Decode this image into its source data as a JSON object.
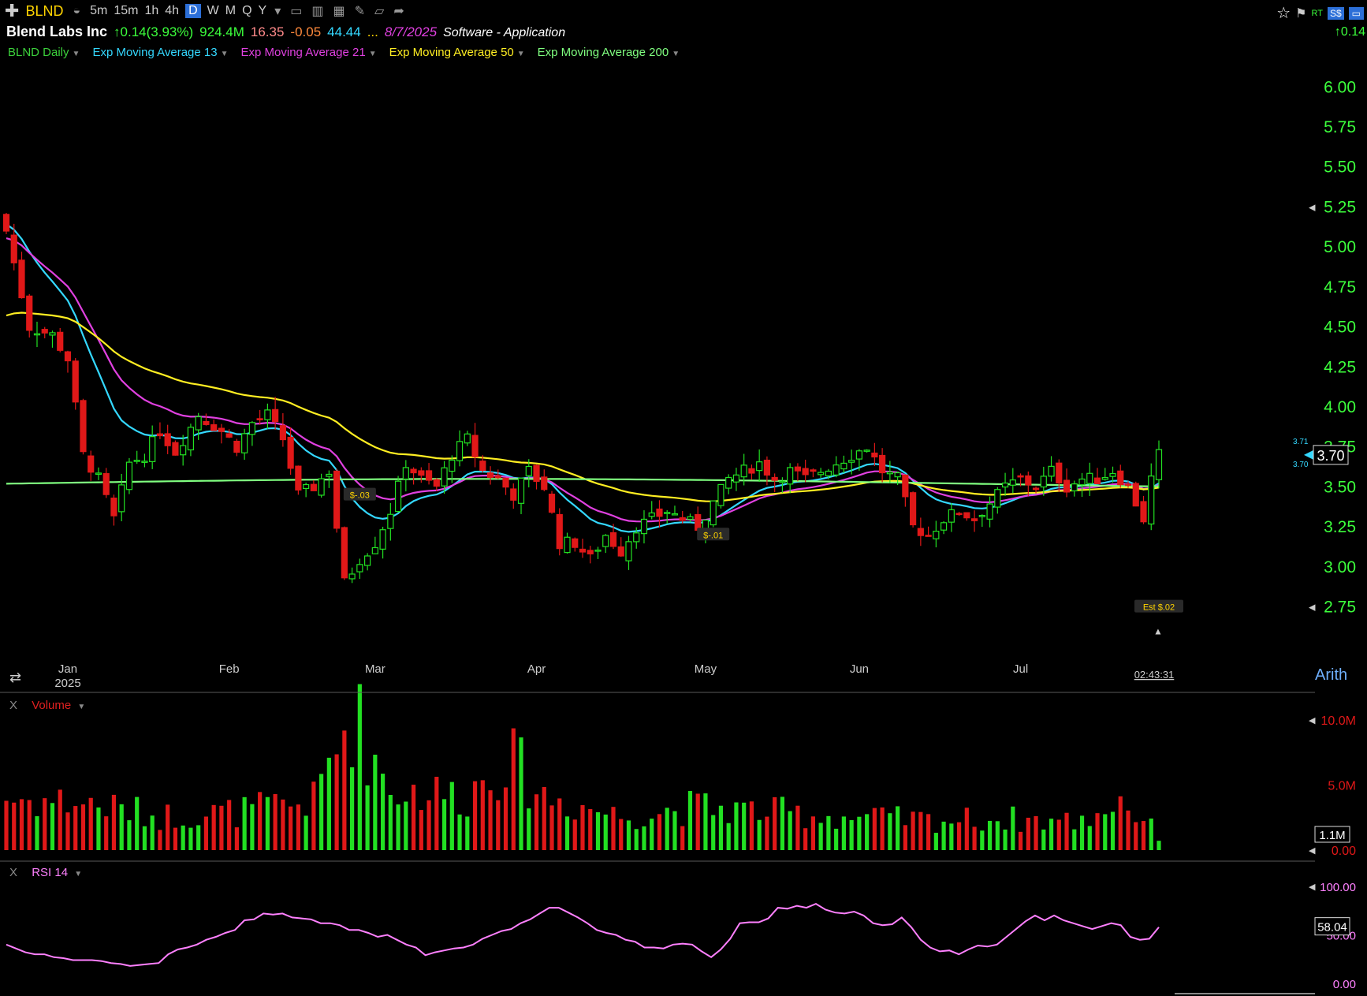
{
  "toolbar": {
    "symbol": "BLND",
    "timeframes": [
      "5m",
      "15m",
      "1h",
      "4h",
      "D",
      "W",
      "M",
      "Q",
      "Y"
    ],
    "active_timeframe": "D",
    "right_badges": [
      "RT"
    ]
  },
  "header": {
    "company": "Blend Labs Inc",
    "change": "↑0.14(3.93%)",
    "volume": "924.4M",
    "val1": "16.35",
    "val2": "-0.05",
    "val3": "44.44",
    "ellipsis": "...",
    "date": "8/7/2025",
    "industry": "Software - Application",
    "right_change": "↑0.14"
  },
  "legend": [
    {
      "label": "BLND Daily",
      "color": "#3cd23c"
    },
    {
      "label": "Exp Moving Average 13",
      "color": "#34d8ff"
    },
    {
      "label": "Exp Moving Average 21",
      "color": "#e040e0"
    },
    {
      "label": "Exp Moving Average 50",
      "color": "#ffee22"
    },
    {
      "label": "Exp Moving Average 200",
      "color": "#80ff80"
    }
  ],
  "chart_data": {
    "type": "candlestick",
    "ylim": [
      2.6,
      6.1
    ],
    "y_ticks": [
      "6.00",
      "5.75",
      "5.50",
      "5.25",
      "5.00",
      "4.75",
      "4.50",
      "4.25",
      "4.00",
      "3.75",
      "3.50",
      "3.25",
      "3.00",
      "2.75"
    ],
    "x_ticks": [
      {
        "label": "Jan",
        "sub": "2025",
        "day": 0
      },
      {
        "label": "Feb",
        "day": 21
      },
      {
        "label": "Mar",
        "day": 40
      },
      {
        "label": "Apr",
        "day": 61
      },
      {
        "label": "May",
        "day": 83
      },
      {
        "label": "Jun",
        "day": 103
      },
      {
        "label": "Jul",
        "day": 124
      }
    ],
    "last_price": "3.70",
    "hi_label": "3.71",
    "lo_label": "3.70",
    "time_label": "02:43:31",
    "earnings": [
      {
        "label": "$-.03",
        "day": 46,
        "price": 3.45
      },
      {
        "label": "$-.01",
        "day": 92,
        "price": 3.2
      },
      {
        "label": "Est $.02",
        "day": 150,
        "price": 2.75
      }
    ],
    "key_points": [
      [
        0,
        5.1
      ],
      [
        3,
        4.5
      ],
      [
        6,
        4.45
      ],
      [
        8,
        4.3
      ],
      [
        10,
        3.7
      ],
      [
        12,
        3.55
      ],
      [
        14,
        3.3
      ],
      [
        16,
        3.65
      ],
      [
        18,
        3.7
      ],
      [
        20,
        3.85
      ],
      [
        22,
        3.72
      ],
      [
        25,
        3.95
      ],
      [
        28,
        3.85
      ],
      [
        30,
        3.75
      ],
      [
        32,
        3.9
      ],
      [
        34,
        3.95
      ],
      [
        36,
        3.8
      ],
      [
        38,
        3.45
      ],
      [
        40,
        3.5
      ],
      [
        42,
        3.6
      ],
      [
        44,
        2.9
      ],
      [
        46,
        3.05
      ],
      [
        48,
        3.15
      ],
      [
        50,
        3.35
      ],
      [
        52,
        3.65
      ],
      [
        54,
        3.55
      ],
      [
        56,
        3.5
      ],
      [
        58,
        3.7
      ],
      [
        60,
        3.8
      ],
      [
        62,
        3.6
      ],
      [
        64,
        3.55
      ],
      [
        66,
        3.45
      ],
      [
        68,
        3.6
      ],
      [
        70,
        3.5
      ],
      [
        72,
        3.15
      ],
      [
        74,
        3.15
      ],
      [
        76,
        3.05
      ],
      [
        78,
        3.2
      ],
      [
        80,
        3.1
      ],
      [
        82,
        3.25
      ],
      [
        84,
        3.3
      ],
      [
        86,
        3.35
      ],
      [
        88,
        3.3
      ],
      [
        90,
        3.25
      ],
      [
        92,
        3.4
      ],
      [
        94,
        3.55
      ],
      [
        96,
        3.6
      ],
      [
        98,
        3.65
      ],
      [
        100,
        3.55
      ],
      [
        102,
        3.6
      ],
      [
        104,
        3.55
      ],
      [
        106,
        3.6
      ],
      [
        108,
        3.65
      ],
      [
        110,
        3.7
      ],
      [
        112,
        3.75
      ],
      [
        114,
        3.6
      ],
      [
        116,
        3.55
      ],
      [
        118,
        3.25
      ],
      [
        120,
        3.2
      ],
      [
        122,
        3.3
      ],
      [
        124,
        3.35
      ],
      [
        126,
        3.3
      ],
      [
        128,
        3.4
      ],
      [
        130,
        3.5
      ],
      [
        132,
        3.55
      ],
      [
        134,
        3.5
      ],
      [
        136,
        3.6
      ],
      [
        138,
        3.5
      ],
      [
        140,
        3.55
      ],
      [
        142,
        3.55
      ],
      [
        144,
        3.6
      ],
      [
        146,
        3.5
      ],
      [
        148,
        3.3
      ],
      [
        149,
        3.55
      ],
      [
        150,
        3.7
      ]
    ],
    "volume": {
      "ylim": [
        0,
        10.5
      ],
      "ticks": [
        "10.0M",
        "5.0M",
        "0.00"
      ],
      "current": "1.1M",
      "key_points": [
        [
          0,
          3.8
        ],
        [
          10,
          3.5
        ],
        [
          20,
          2.5
        ],
        [
          30,
          2.8
        ],
        [
          40,
          3.6
        ],
        [
          45,
          10.2
        ],
        [
          50,
          4.5
        ],
        [
          60,
          4.0
        ],
        [
          65,
          7.0
        ],
        [
          70,
          4.0
        ],
        [
          80,
          2.5
        ],
        [
          90,
          3.2
        ],
        [
          100,
          2.8
        ],
        [
          110,
          2.4
        ],
        [
          120,
          2.2
        ],
        [
          130,
          2.3
        ],
        [
          140,
          2.1
        ],
        [
          145,
          3.8
        ],
        [
          150,
          1.1
        ]
      ]
    },
    "rsi": {
      "label": "RSI 14",
      "ylim": [
        0,
        100
      ],
      "ticks": [
        "100.00",
        "50.00",
        "0.00"
      ],
      "current": "58.04",
      "values": [
        40,
        36,
        32,
        30,
        30,
        27,
        26,
        24,
        24,
        24,
        23,
        21,
        20,
        18,
        19,
        20,
        21,
        30,
        35,
        37,
        40,
        45,
        48,
        52,
        55,
        65,
        66,
        72,
        71,
        72,
        68,
        67,
        66,
        62,
        62,
        60,
        55,
        55,
        52,
        48,
        50,
        45,
        40,
        37,
        29,
        32,
        34,
        36,
        37,
        40,
        46,
        50,
        54,
        56,
        62,
        66,
        72,
        78,
        78,
        73,
        68,
        62,
        55,
        52,
        50,
        45,
        43,
        37,
        37,
        36,
        40,
        41,
        40,
        33,
        27,
        35,
        46,
        62,
        63,
        63,
        67,
        78,
        77,
        80,
        78,
        82,
        76,
        73,
        72,
        74,
        70,
        62,
        60,
        61,
        68,
        58,
        45,
        37,
        33,
        34,
        30,
        35,
        39,
        38,
        40,
        48,
        56,
        64,
        70,
        65,
        70,
        65,
        62,
        59,
        56,
        59,
        62,
        60,
        48,
        45,
        46,
        58
      ]
    }
  }
}
